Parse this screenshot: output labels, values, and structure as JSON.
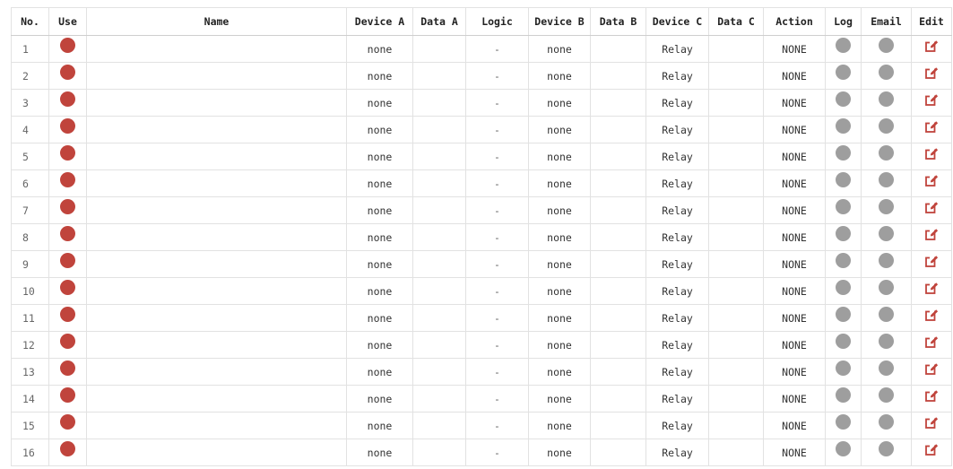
{
  "table": {
    "headers": {
      "no": "No.",
      "use": "Use",
      "name": "Name",
      "device_a": "Device A",
      "data_a": "Data A",
      "logic": "Logic",
      "device_b": "Device B",
      "data_b": "Data B",
      "device_c": "Device C",
      "data_c": "Data C",
      "action": "Action",
      "log": "Log",
      "email": "Email",
      "edit": "Edit"
    },
    "rows": [
      {
        "no": "1",
        "name": "",
        "device_a": "none",
        "data_a": "",
        "logic": "-",
        "device_b": "none",
        "data_b": "",
        "device_c": "Relay",
        "data_c": "",
        "action": "NONE"
      },
      {
        "no": "2",
        "name": "",
        "device_a": "none",
        "data_a": "",
        "logic": "-",
        "device_b": "none",
        "data_b": "",
        "device_c": "Relay",
        "data_c": "",
        "action": "NONE"
      },
      {
        "no": "3",
        "name": "",
        "device_a": "none",
        "data_a": "",
        "logic": "-",
        "device_b": "none",
        "data_b": "",
        "device_c": "Relay",
        "data_c": "",
        "action": "NONE"
      },
      {
        "no": "4",
        "name": "",
        "device_a": "none",
        "data_a": "",
        "logic": "-",
        "device_b": "none",
        "data_b": "",
        "device_c": "Relay",
        "data_c": "",
        "action": "NONE"
      },
      {
        "no": "5",
        "name": "",
        "device_a": "none",
        "data_a": "",
        "logic": "-",
        "device_b": "none",
        "data_b": "",
        "device_c": "Relay",
        "data_c": "",
        "action": "NONE"
      },
      {
        "no": "6",
        "name": "",
        "device_a": "none",
        "data_a": "",
        "logic": "-",
        "device_b": "none",
        "data_b": "",
        "device_c": "Relay",
        "data_c": "",
        "action": "NONE"
      },
      {
        "no": "7",
        "name": "",
        "device_a": "none",
        "data_a": "",
        "logic": "-",
        "device_b": "none",
        "data_b": "",
        "device_c": "Relay",
        "data_c": "",
        "action": "NONE"
      },
      {
        "no": "8",
        "name": "",
        "device_a": "none",
        "data_a": "",
        "logic": "-",
        "device_b": "none",
        "data_b": "",
        "device_c": "Relay",
        "data_c": "",
        "action": "NONE"
      },
      {
        "no": "9",
        "name": "",
        "device_a": "none",
        "data_a": "",
        "logic": "-",
        "device_b": "none",
        "data_b": "",
        "device_c": "Relay",
        "data_c": "",
        "action": "NONE"
      },
      {
        "no": "10",
        "name": "",
        "device_a": "none",
        "data_a": "",
        "logic": "-",
        "device_b": "none",
        "data_b": "",
        "device_c": "Relay",
        "data_c": "",
        "action": "NONE"
      },
      {
        "no": "11",
        "name": "",
        "device_a": "none",
        "data_a": "",
        "logic": "-",
        "device_b": "none",
        "data_b": "",
        "device_c": "Relay",
        "data_c": "",
        "action": "NONE"
      },
      {
        "no": "12",
        "name": "",
        "device_a": "none",
        "data_a": "",
        "logic": "-",
        "device_b": "none",
        "data_b": "",
        "device_c": "Relay",
        "data_c": "",
        "action": "NONE"
      },
      {
        "no": "13",
        "name": "",
        "device_a": "none",
        "data_a": "",
        "logic": "-",
        "device_b": "none",
        "data_b": "",
        "device_c": "Relay",
        "data_c": "",
        "action": "NONE"
      },
      {
        "no": "14",
        "name": "",
        "device_a": "none",
        "data_a": "",
        "logic": "-",
        "device_b": "none",
        "data_b": "",
        "device_c": "Relay",
        "data_c": "",
        "action": "NONE"
      },
      {
        "no": "15",
        "name": "",
        "device_a": "none",
        "data_a": "",
        "logic": "-",
        "device_b": "none",
        "data_b": "",
        "device_c": "Relay",
        "data_c": "",
        "action": "NONE"
      },
      {
        "no": "16",
        "name": "",
        "device_a": "none",
        "data_a": "",
        "logic": "-",
        "device_b": "none",
        "data_b": "",
        "device_c": "Relay",
        "data_c": "",
        "action": "NONE"
      }
    ]
  },
  "indicators": {
    "use_icon": "status-dot-icon",
    "log_icon": "status-dot-icon",
    "email_icon": "status-dot-icon",
    "edit_icon": "edit-icon"
  },
  "colors": {
    "use_active": "#c0443c",
    "inactive": "#9e9e9e",
    "edit": "#c0443c"
  }
}
